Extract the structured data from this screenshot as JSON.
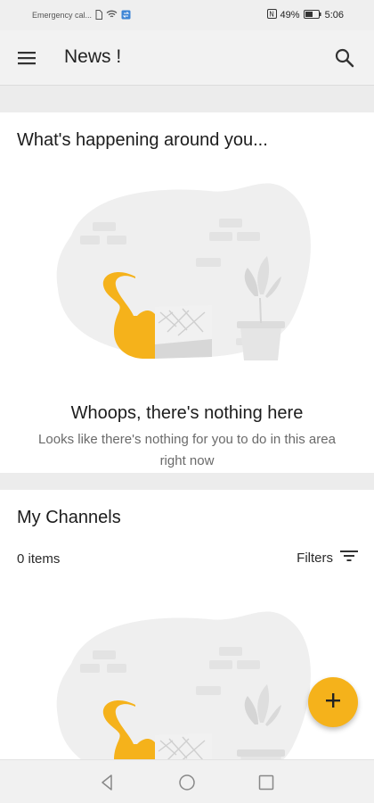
{
  "status_bar": {
    "carrier": "Emergency cal...",
    "battery": "49%",
    "time": "5:06",
    "icons": [
      "sim-icon",
      "wifi-icon",
      "data-sync-icon",
      "nfc-icon",
      "battery-icon"
    ]
  },
  "app_bar": {
    "title": "News !",
    "menu_icon": "hamburger-menu-icon",
    "search_icon": "search-icon"
  },
  "happening": {
    "title": "What's happening around you...",
    "empty_title": "Whoops, there's nothing here",
    "empty_subtitle": "Looks like there's nothing for you to do in this area right now"
  },
  "channels": {
    "title": "My Channels",
    "items_count": "0 items",
    "filters_label": "Filters",
    "filters_icon": "filter-icon"
  },
  "fab": {
    "icon": "plus-icon"
  },
  "nav_bar": {
    "icons": [
      "back-icon",
      "home-icon",
      "recent-apps-icon"
    ]
  },
  "colors": {
    "accent": "#f5b21b",
    "background": "#ececec",
    "card": "#ffffff",
    "illustration_gray": "#efefef"
  }
}
